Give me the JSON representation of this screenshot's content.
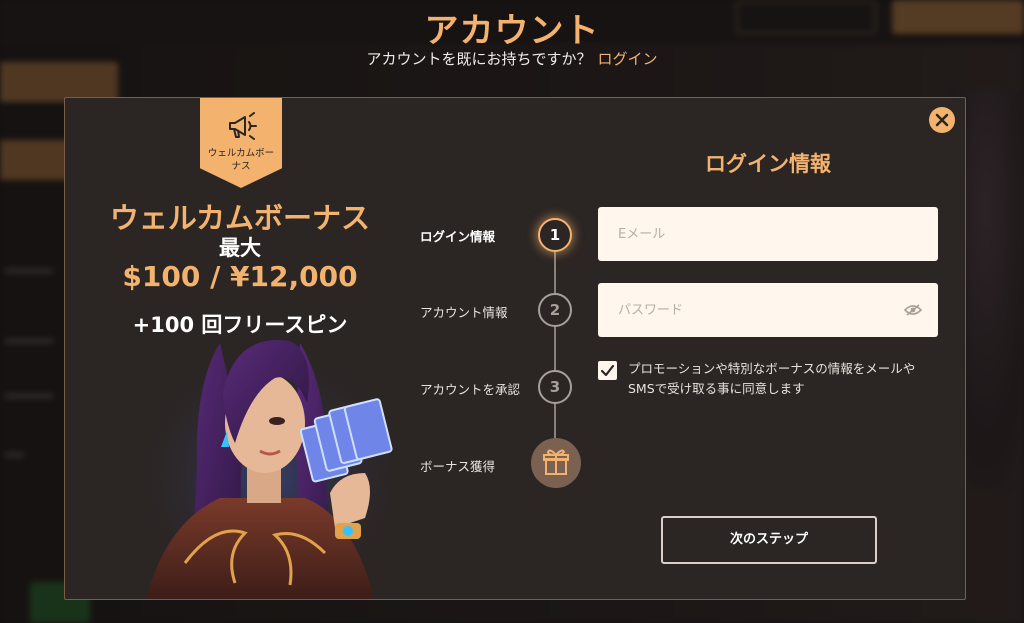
{
  "heading": "アカウント",
  "subheading": {
    "prompt": "アカウントを既にお持ちですか？",
    "login_link": "ログイン"
  },
  "promo": {
    "ribbon_label": "ウェルカムボーナス",
    "title": "ウェルカムボーナス",
    "max_label": "最大",
    "amount": "$100 / ¥12,000",
    "spins": "+100 回フリースピン"
  },
  "steps": [
    {
      "label": "ログイン情報",
      "number": "1",
      "active": true
    },
    {
      "label": "アカウント情報",
      "number": "2",
      "active": false
    },
    {
      "label": "アカウントを承認",
      "number": "3",
      "active": false
    },
    {
      "label": "ボーナス獲得",
      "icon": "gift-icon",
      "active": false
    }
  ],
  "form": {
    "title": "ログイン情報",
    "email_placeholder": "Eメール",
    "password_placeholder": "パスワード",
    "consent_checked": true,
    "consent_text": "プロモーションや特別なボーナスの情報をメールやSMSで受け取る事に同意します",
    "next_button": "次のステップ"
  },
  "colors": {
    "accent": "#f3b36f",
    "modal_bg": "#2b2523",
    "input_bg": "#fff7ee"
  }
}
